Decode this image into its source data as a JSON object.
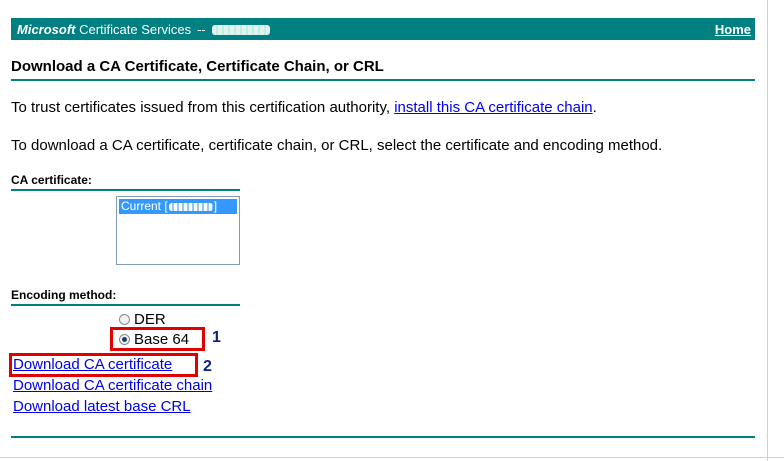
{
  "banner": {
    "brand_bold": "Microsoft",
    "brand_rest": " Certificate Services",
    "separator": "--",
    "home_link": "Home"
  },
  "page_title": "Download a CA Certificate, Certificate Chain, or CRL",
  "trust_text": "To trust certificates issued from this certification authority, ",
  "trust_link": "install this CA certificate chain",
  "trust_end": ".",
  "download_text": "To download a CA certificate, certificate chain, or CRL, select the certificate and encoding method.",
  "ca_certificate": {
    "label": "CA certificate:",
    "selected_prefix": "Current [",
    "selected_suffix": "]"
  },
  "encoding": {
    "label": "Encoding method:",
    "options": [
      {
        "label": "DER",
        "checked": false
      },
      {
        "label": "Base 64",
        "checked": true
      }
    ]
  },
  "annotations": [
    "1",
    "2"
  ],
  "download_links": [
    "Download CA certificate",
    "Download CA certificate chain",
    "Download latest base CRL"
  ],
  "colors": {
    "accent": "#008080",
    "highlight": "#e00000",
    "link": "#0000ee",
    "annotation": "#0b1f8a"
  }
}
